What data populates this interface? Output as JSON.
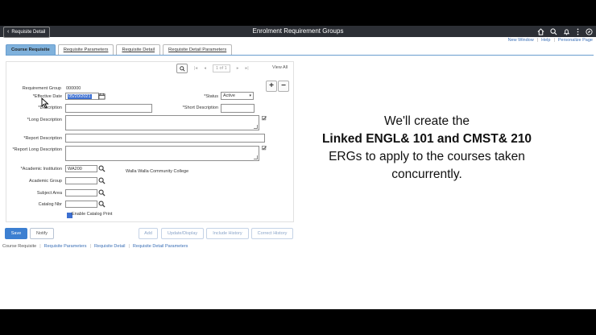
{
  "header": {
    "back_label": "Requisite Detail",
    "title": "Enrolment Requirement Groups",
    "icons": [
      "home-icon",
      "search-icon",
      "bell-icon",
      "more-vertical-icon",
      "compass-icon"
    ]
  },
  "util_links": {
    "new_window": "New Window",
    "help": "Help",
    "personalize": "Personalize Page"
  },
  "tabs": [
    {
      "label": "Course Requisite",
      "active": true
    },
    {
      "label": "Requisite Parameters",
      "active": false
    },
    {
      "label": "Requisite Detail",
      "active": false
    },
    {
      "label": "Requisite Detail Parameters",
      "active": false
    }
  ],
  "nav": {
    "count": "1 of 1",
    "view_all": "View All"
  },
  "form": {
    "requirement_group_label": "Requirement Group",
    "requirement_group_value": "000000",
    "effective_date_label": "*Effective Date",
    "effective_date_value": "05/20/2021",
    "status_label": "*Status",
    "status_value": "Active",
    "description_label": "*Description",
    "short_description_label": "*Short Description",
    "long_description_label": "*Long Description",
    "report_description_label": "*Report Description",
    "report_long_description_label": "*Report Long Description",
    "academic_institution_label": "*Academic Institution",
    "academic_institution_value": "WA200",
    "institution_name": "Walla Walla Community College",
    "academic_group_label": "Academic Group",
    "subject_area_label": "Subject Area",
    "catalog_nbr_label": "Catalog Nbr",
    "enable_catalog_print_label": "Enable Catalog Print",
    "enable_catalog_print_checked": true
  },
  "buttons": {
    "save": "Save",
    "notify": "Notify",
    "add": "Add",
    "update_display": "Update/Display",
    "include_history": "Include History",
    "correct_history": "Correct History"
  },
  "bottom_links": {
    "course_requisite": "Course Requisite",
    "requisite_parameters": "Requisite Parameters",
    "requisite_detail": "Requisite Detail",
    "requisite_detail_parameters": "Requisite Detail Parameters"
  },
  "overlay": {
    "line1": "We'll create the",
    "line2": "Linked ENGL& 101 and CMST& 210",
    "line3": "ERGs to apply to the courses taken",
    "line4": "concurrently."
  },
  "colors": {
    "banner": "#2c2f35",
    "active_tab": "#7fb1dc",
    "primary_button": "#3c7fd1",
    "link": "#3a6fb6"
  }
}
